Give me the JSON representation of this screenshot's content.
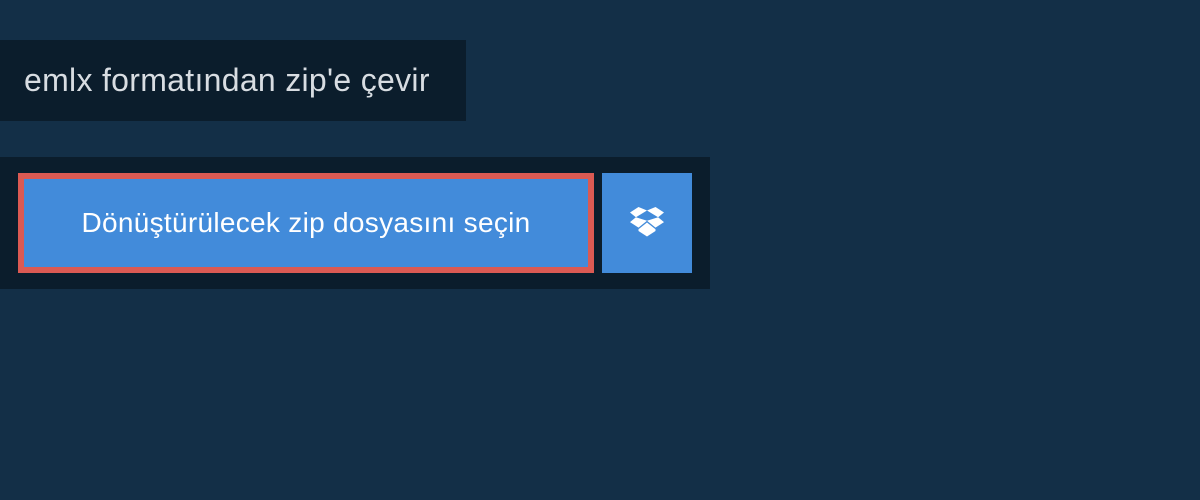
{
  "header": {
    "title": "emlx formatından zip'e çevir"
  },
  "upload": {
    "select_button_label": "Dönüştürülecek zip dosyasını seçin"
  },
  "colors": {
    "bg_outer": "#132f47",
    "bg_inner": "#0b1d2c",
    "button_bg": "#428bda",
    "button_border": "#db5a53",
    "text_light": "#d8dde2",
    "text_white": "#ffffff"
  }
}
